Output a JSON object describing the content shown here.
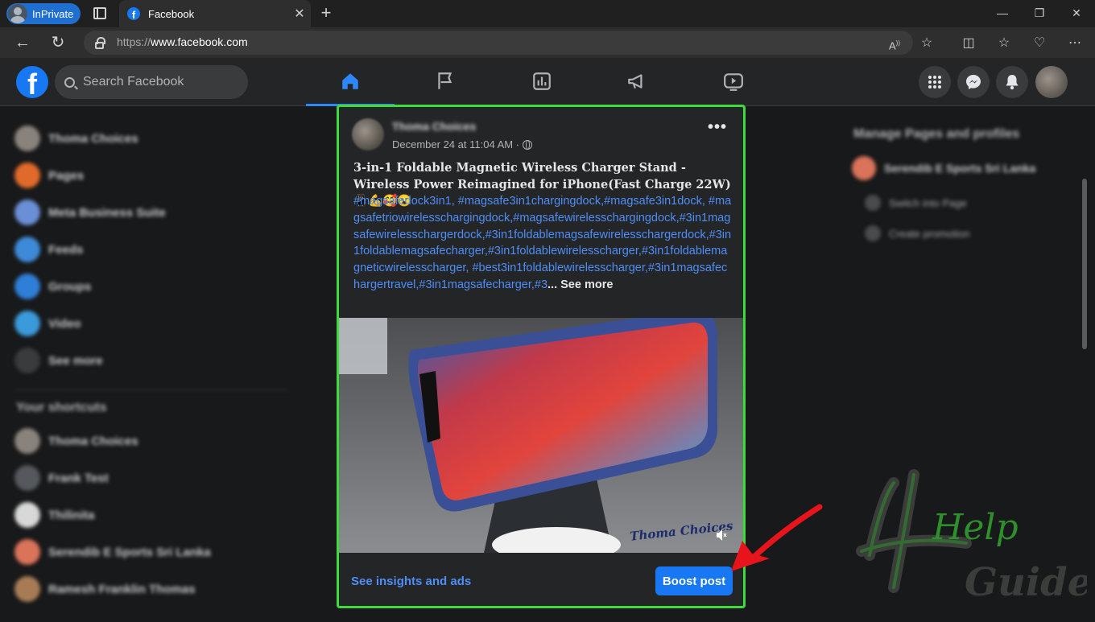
{
  "browser": {
    "inprivate_label": "InPrivate",
    "tab_title": "Facebook",
    "url_proto": "https://",
    "url_host": "www.facebook.com"
  },
  "fb": {
    "search_placeholder": "Search Facebook"
  },
  "left_sidebar": {
    "items": [
      "Thoma Choices",
      "Pages",
      "Meta Business Suite",
      "Feeds",
      "Groups",
      "Video",
      "See more"
    ],
    "shortcuts_heading": "Your shortcuts",
    "shortcuts": [
      "Thoma Choices",
      "Frank Test",
      "Thilinita",
      "Serendib E Sports Sri Lanka",
      "Ramesh Franklin Thomas"
    ]
  },
  "right_sidebar": {
    "title": "Manage Pages and profiles",
    "page_name": "Serendib E Sports Sri Lanka",
    "switch_label": "Switch into Page",
    "promo_label": "Create promotion"
  },
  "post": {
    "author": "Thoma Choices",
    "date": "December 24 at 11:04 AM · ",
    "title": "3-in-1 Foldable Magnetic Wireless Charger Stand - Wireless Power Reimagined for iPhone(Fast Charge 22W) 📱💪🥰😮",
    "tags": "#magsafedock3in1, #magsafe3in1chargingdock,#magsafe3in1dock, #magsafetriowirelesschargingdock,#magsafewirelesschargingdock,#3in1magsafewirelesschargerdock,#3in1foldablemagsafewirelesschargerdock,#3in1foldablemagsafecharger,#3in1foldablewirelesscharger,#3in1foldablemagneticwirelesscharger, #best3in1foldablewirelesscharger,#3in1magsafechargertravel,#3in1magsafecharger,#3",
    "see_more": "... See more",
    "image_watermark": "Thoma Choices",
    "insights_label": "See insights and ads",
    "boost_label": "Boost post"
  },
  "overlay": {
    "arrow_color": "#e8141b",
    "highlight_color": "#3ddc3a",
    "logo_text_top": "Help",
    "logo_text_bottom": "Guider"
  }
}
